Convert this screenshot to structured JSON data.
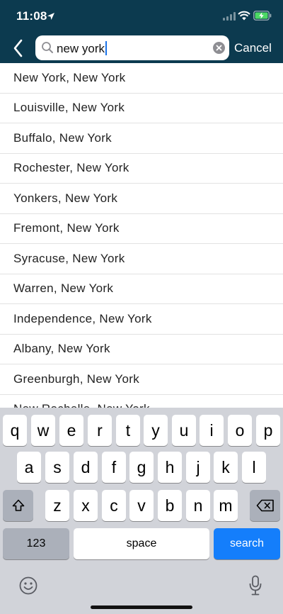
{
  "status": {
    "time": "11:08"
  },
  "search": {
    "value": "new york",
    "cancel_label": "Cancel"
  },
  "results": [
    "New York, New York",
    "Louisville, New York",
    "Buffalo, New York",
    "Rochester, New York",
    "Yonkers, New York",
    "Fremont, New York",
    "Syracuse, New York",
    "Warren, New York",
    "Independence, New York",
    "Albany, New York",
    "Greenburgh, New York",
    "New Rochelle, New York"
  ],
  "keyboard": {
    "row1": [
      "q",
      "w",
      "e",
      "r",
      "t",
      "y",
      "u",
      "i",
      "o",
      "p"
    ],
    "row2": [
      "a",
      "s",
      "d",
      "f",
      "g",
      "h",
      "j",
      "k",
      "l"
    ],
    "row3": [
      "z",
      "x",
      "c",
      "v",
      "b",
      "n",
      "m"
    ],
    "numbers_label": "123",
    "space_label": "space",
    "search_label": "search"
  },
  "colors": {
    "header": "#0c3a4f",
    "accent": "#147efb",
    "battery": "#4cd964"
  },
  "icons": [
    "location-arrow-icon",
    "cellular-signal-icon",
    "wifi-icon",
    "battery-charging-icon",
    "back-chevron-icon",
    "search-icon",
    "clear-icon",
    "shift-icon",
    "backspace-icon",
    "emoji-icon",
    "microphone-icon"
  ]
}
